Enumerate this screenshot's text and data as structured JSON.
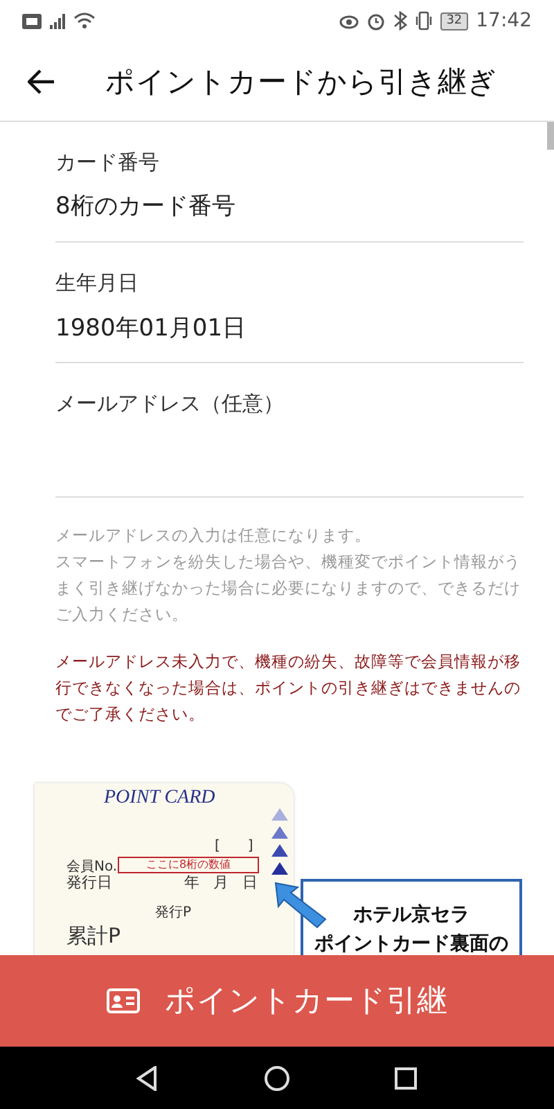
{
  "status_bar": {
    "battery": "32",
    "time": "17:42"
  },
  "app_bar": {
    "title": "ポイントカードから引き継ぎ"
  },
  "fields": [
    {
      "label": "カード番号",
      "placeholder": "8桁のカード番号"
    },
    {
      "label": "生年月日",
      "value": "1980年01月01日"
    },
    {
      "label": "メールアドレス（任意）"
    }
  ],
  "notes": [
    {
      "kind": "info",
      "text": "メールアドレスの入力は任意になります。"
    },
    {
      "kind": "info",
      "text": "スマートフォンを紛失した場合や、機種変でポイント情報がうまく引き継げなかった場合に必要になりますので、できるだけご入力ください。"
    },
    {
      "kind": "warning",
      "text": "メールアドレス未入力で、機種の紛失、故障等で会員情報が移行できなくなった場合は、ポイントの引き継ぎはできませんのでご了承ください。"
    }
  ],
  "card_image": {
    "title": "POINT CARD",
    "bracket": "[　　]",
    "member_no_label": "会員No.",
    "member_no_hint": "ここに8桁の数値",
    "issue_date_label": "発行日",
    "date_units": [
      "年",
      "月",
      "日"
    ],
    "issued_points_label": "発行P",
    "total_points_label": "累計P"
  },
  "callout": {
    "lines": [
      "ホテル京セラ",
      "ポイントカード裏面の"
    ]
  },
  "action_button": {
    "label": "ポイントカード引継"
  }
}
